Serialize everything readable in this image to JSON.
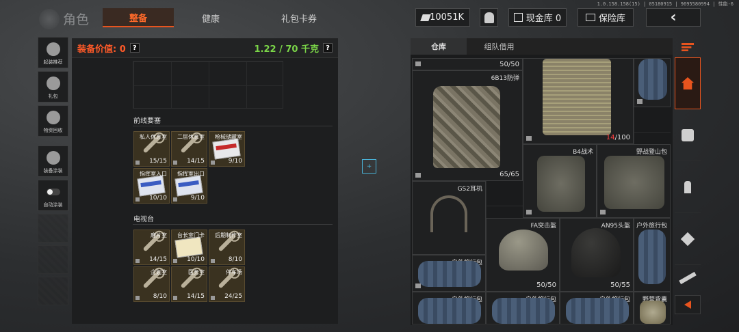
{
  "version": "1.0.158.158(15) | 05180915 | 96955809​94 | 性能-6",
  "header": {
    "title": "角色",
    "tabs": [
      {
        "label": "整备",
        "active": true
      },
      {
        "label": "健康",
        "active": false
      },
      {
        "label": "礼包卡券",
        "active": false
      }
    ],
    "money": "10051K",
    "cash_vault": "现金库 0",
    "safe": "保险库",
    "back_icon": "‹"
  },
  "left_sidebar": [
    {
      "label": "起装推荐",
      "icon": "helmet-star-icon"
    },
    {
      "label": "礼包",
      "icon": "gift-icon"
    },
    {
      "label": "物资回收",
      "icon": "recycle-icon"
    },
    {
      "label": "装备涂装",
      "icon": "paint-icon"
    },
    {
      "label": "自动涂装",
      "icon": "toggle-icon"
    }
  ],
  "equipment": {
    "value_label": "装备价值: 0",
    "weight": "1.22 / 70 千克",
    "help": "?"
  },
  "sections": [
    {
      "title": "前线要塞",
      "keys": [
        {
          "name": "私人休息室",
          "count": "15/15",
          "kind": "key"
        },
        {
          "name": "二层休息室",
          "count": "14/15",
          "kind": "key"
        },
        {
          "name": "枪械储藏室",
          "count": "9/10",
          "kind": "card-red"
        },
        {
          "name": "指挥室入口",
          "count": "10/10",
          "kind": "card-blue"
        },
        {
          "name": "指挥室出口",
          "count": "9/10",
          "kind": "card-blue"
        }
      ]
    },
    {
      "title": "电视台",
      "keys": [
        {
          "name": "磨片室",
          "count": "14/15",
          "kind": "key"
        },
        {
          "name": "台长室门卡",
          "count": "10/10",
          "kind": "card"
        },
        {
          "name": "后期制作室",
          "count": "8/10",
          "kind": "key"
        },
        {
          "name": "企划室",
          "count": "8/10",
          "kind": "key"
        },
        {
          "name": "医务室",
          "count": "14/15",
          "kind": "key"
        },
        {
          "name": "停车场",
          "count": "24/25",
          "kind": "key"
        }
      ]
    }
  ],
  "storage": {
    "tabs": [
      {
        "label": "仓库",
        "active": true
      },
      {
        "label": "组队借用",
        "active": false
      }
    ],
    "items": {
      "top_count": "50/50",
      "vest_name": "6B13防弹",
      "vest_count": "65/65",
      "plate_count_cur": "14",
      "plate_count_max": "/100",
      "b4_name": "B4战术",
      "hiking_bag_name": "野战登山包",
      "gs2_name": "GS2耳机",
      "fa_name": "FA突击盔",
      "fa_count": "50/50",
      "an95_name": "AN95头盔",
      "an95_count": "50/55",
      "travel_name": "户外旅行包",
      "camp_name": "野营背囊"
    }
  },
  "colors": {
    "accent": "#e8541e",
    "weight_green": "#7bd648",
    "value_red": "#ff5a28"
  }
}
